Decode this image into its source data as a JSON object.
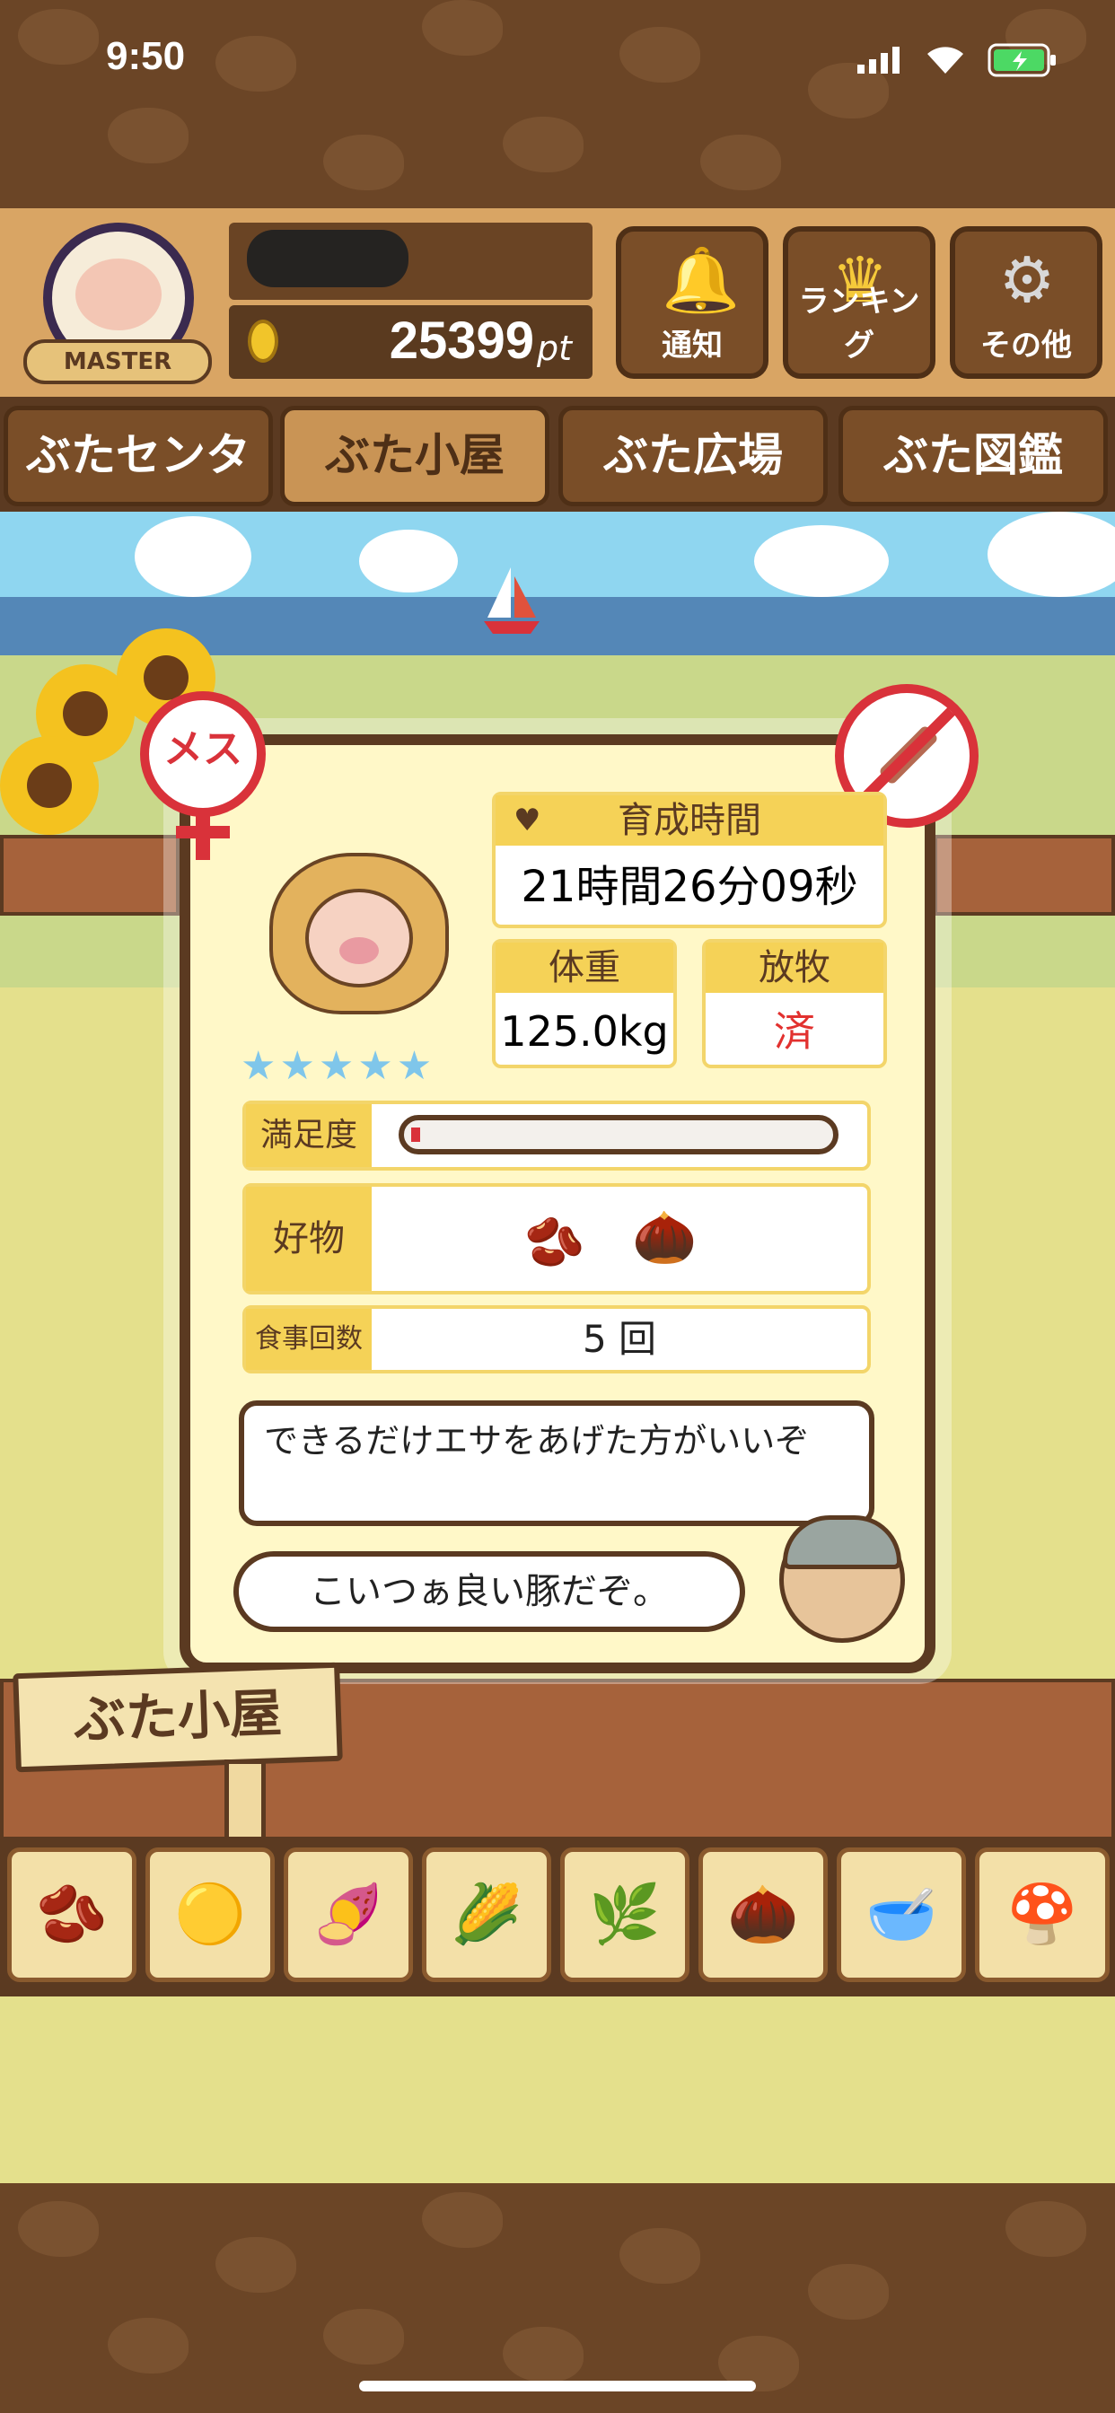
{
  "status_bar": {
    "time": "9:50"
  },
  "header": {
    "badge_label": "MASTER",
    "points_value": "25399",
    "points_unit": "pt",
    "buttons": [
      {
        "label": "通知",
        "icon": "bell-icon"
      },
      {
        "label": "ランキング",
        "icon": "crown-icon"
      },
      {
        "label": "その他",
        "icon": "gear-icon"
      }
    ]
  },
  "tabs": [
    {
      "label": "ぶたセンター"
    },
    {
      "label": "ぶた小屋"
    },
    {
      "label": "ぶた広場"
    },
    {
      "label": "ぶた図鑑"
    }
  ],
  "active_tab": "ぶた小屋",
  "card": {
    "gender_label": "メス",
    "breeding_time_label": "育成時間",
    "breeding_time_value": "21時間26分09秒",
    "weight_label": "体重",
    "weight_value": "125.0kg",
    "grazing_label": "放牧",
    "grazing_value": "済",
    "stars": "★★★★★",
    "satisfaction_label": "満足度",
    "satisfaction_level": 0.02,
    "favorite_label": "好物",
    "meal_count_label": "食事回数",
    "meal_count_value": "5 回",
    "tip_message": "できるだけエサをあげた方がいいぞ",
    "farmer_message": "こいつぁ良い豚だぞ。"
  },
  "sign_label": "ぶた小屋",
  "food_items": [
    "soybeans",
    "mixed-beans",
    "sweet-potato",
    "corn",
    "herb-beans",
    "acorns",
    "bean-bowl",
    "truffles"
  ],
  "colors": {
    "accent": "#f5d257",
    "brown": "#5b3a21",
    "female": "#d9323a",
    "star": "#7fc6ea"
  }
}
